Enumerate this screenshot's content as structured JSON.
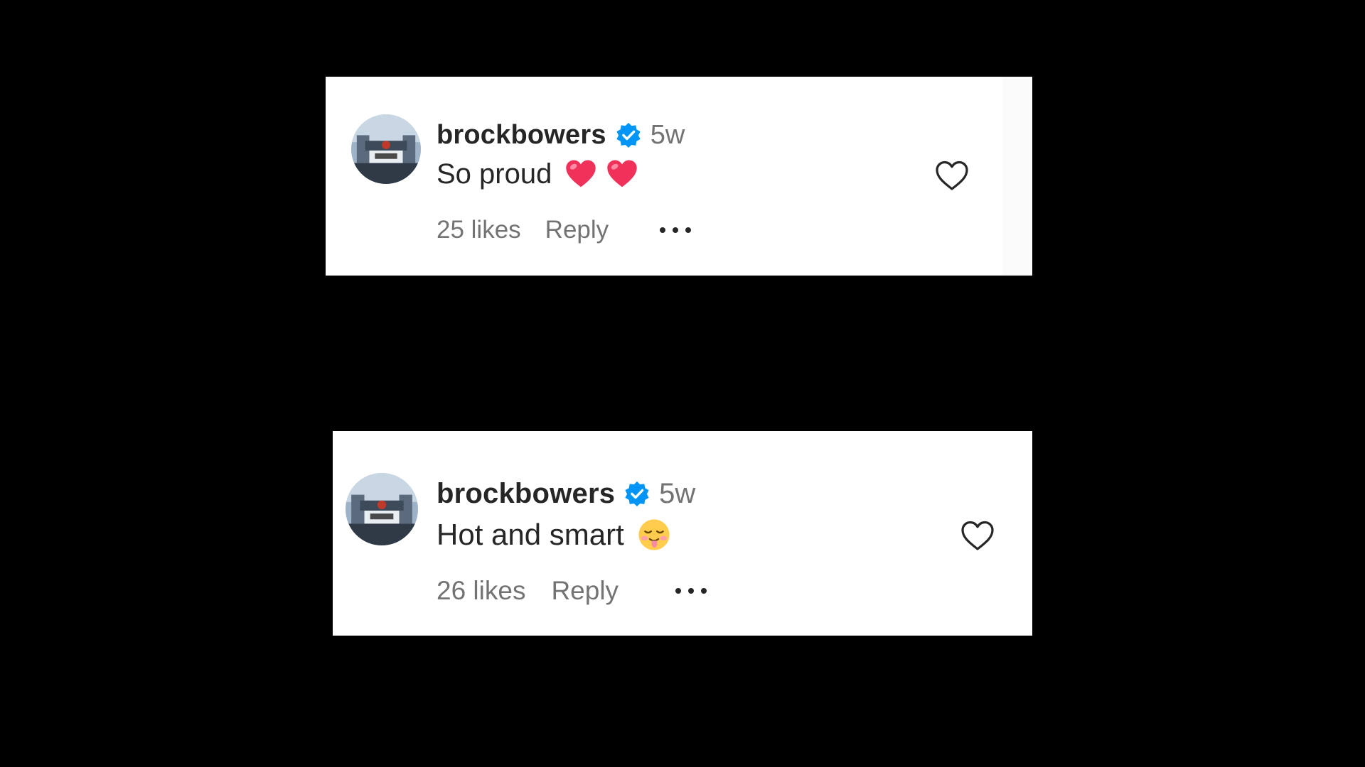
{
  "comments": [
    {
      "username": "brockbowers",
      "time": "5w",
      "text": "So proud",
      "emojis": [
        "red-heart",
        "red-heart"
      ],
      "likes": "25 likes",
      "reply": "Reply"
    },
    {
      "username": "brockbowers",
      "time": "5w",
      "text": "Hot and smart",
      "emojis": [
        "drooling-face"
      ],
      "likes": "26 likes",
      "reply": "Reply"
    }
  ],
  "icons": {
    "verified": "verified-badge-icon",
    "more": "more-options-icon",
    "like": "heart-outline-icon"
  },
  "colors": {
    "background": "#000000",
    "card": "#ffffff",
    "text_primary": "#262626",
    "text_secondary": "#737373",
    "verified_blue": "#0095f6",
    "heart_red": "#f0325a"
  }
}
